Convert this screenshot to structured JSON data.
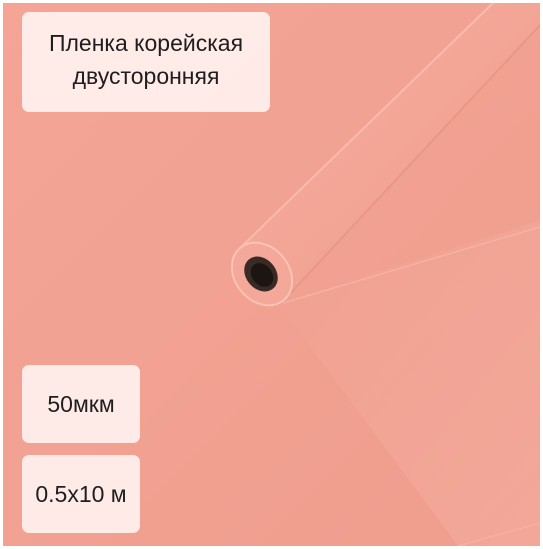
{
  "title": {
    "line1": "Пленка корейская",
    "line2": "двусторонняя"
  },
  "specs": {
    "thickness": "50мкм",
    "size": "0.5х10 м"
  },
  "colors": {
    "film": "#f2a394",
    "label_background": "#fff0ee",
    "text": "#1e1e1e"
  }
}
